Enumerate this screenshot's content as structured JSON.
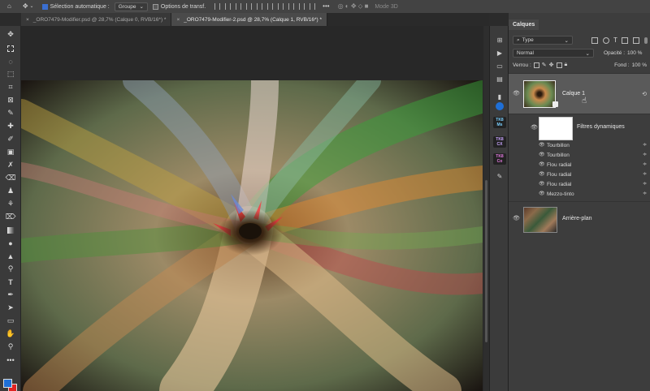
{
  "options_bar": {
    "auto_select_label": "Sélection automatique :",
    "auto_select_value": "Groupe",
    "transform_label": "Options de transf.",
    "mode3d_label": "Mode 3D"
  },
  "tabs": [
    {
      "label": "_ORO7479-Modifier.psd @ 28,7% (Calque 0, RVB/16*) *",
      "close": "×"
    },
    {
      "label": "_ORO7479-Modifier-2.psd @ 28,7% (Calque 1, RVB/16*) *",
      "close": "×"
    }
  ],
  "layers_panel": {
    "tab_label": "Calques",
    "filter_type": "Type",
    "blend_mode": "Normal",
    "opacity_label": "Opacité :",
    "opacity_value": "100 %",
    "lock_label": "Verrou :",
    "fill_label": "Fond :",
    "fill_value": "100 %",
    "layers": [
      {
        "name": "Calque 1"
      },
      {
        "name": "Filtres dynamiques"
      },
      {
        "name": "Arrière-plan"
      }
    ],
    "filters": [
      "Tourbillon",
      "Tourbillon",
      "Flou radial",
      "Flou radial",
      "Flou radial",
      "Mezzo-tinto"
    ]
  },
  "strip": {
    "tk1": "TK8\nMs",
    "tk2": "TK8\nCX",
    "tk3": "TK8\nCo"
  },
  "colors": {
    "foreground": "#1f6fd6",
    "background": "#e02323"
  }
}
